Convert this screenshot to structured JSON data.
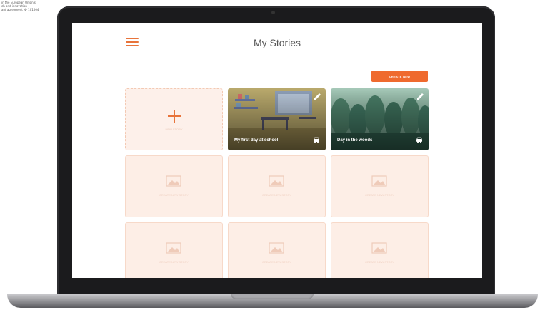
{
  "corner_note": [
    "in the European Union's",
    "ch and innovation",
    "ant agreement Nº 101004"
  ],
  "header": {
    "title": "My Stories",
    "menu_icon": "hamburger-menu-icon"
  },
  "toolbar": {
    "create_new_label": "CREATE NEW"
  },
  "add_card": {
    "label": "NEW STORY"
  },
  "stories": [
    {
      "title": "My first day at school",
      "theme": "classroom"
    },
    {
      "title": "Day in the woods",
      "theme": "forest"
    }
  ],
  "empty_slots": [
    {
      "label": "CREATE NEW STORY"
    },
    {
      "label": "CREATE NEW STORY"
    },
    {
      "label": "CREATE NEW STORY"
    },
    {
      "label": "CREATE NEW STORY"
    },
    {
      "label": "CREATE NEW STORY"
    },
    {
      "label": "CREATE NEW STORY"
    }
  ],
  "colors": {
    "accent": "#ef6a2e",
    "placeholder_bg": "#fdeee6",
    "bezel": "#1b1b1d"
  }
}
